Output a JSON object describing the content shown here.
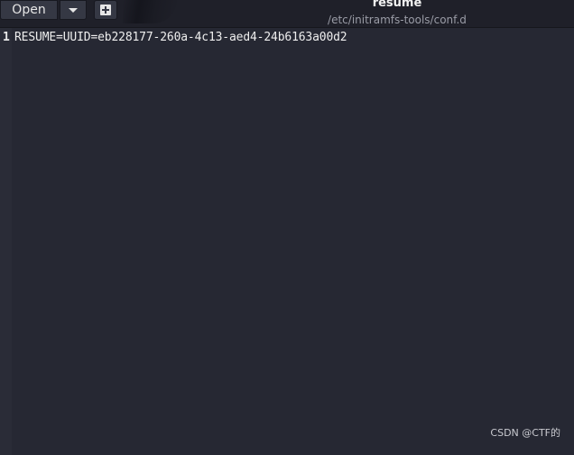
{
  "toolbar": {
    "open_label": "Open",
    "open_menu_icon": "chevron-down-icon",
    "new_tab_icon": "new-document-icon"
  },
  "header": {
    "title": "resume",
    "path": "/etc/initramfs-tools/conf.d"
  },
  "editor": {
    "lines": [
      {
        "number": "1",
        "text": "RESUME=UUID=eb228177-260a-4c13-aed4-24b6163a00d2"
      }
    ]
  },
  "watermark": "CSDN @CTF的",
  "colors": {
    "background": "#262833",
    "header": "#1f2029",
    "button": "#353844"
  }
}
